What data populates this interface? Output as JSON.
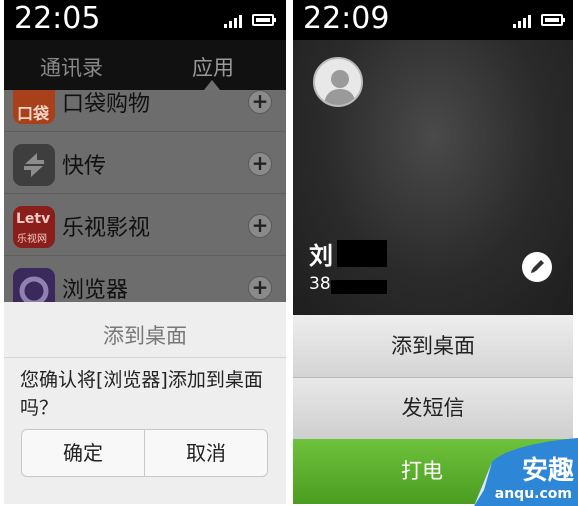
{
  "left_screen": {
    "status": {
      "time": "22:05"
    },
    "tabs": [
      {
        "label": "通讯录"
      },
      {
        "label": "应用"
      }
    ],
    "apps": [
      {
        "name": "口袋购物",
        "icon": "koudai-icon",
        "icon_text": "口袋"
      },
      {
        "name": "快传",
        "icon": "kuaichuan-icon"
      },
      {
        "name": "乐视影视",
        "icon": "letv-icon",
        "icon_text_top": "Letv",
        "icon_text_bottom": "乐视网"
      },
      {
        "name": "浏览器",
        "icon": "browser-icon"
      }
    ],
    "add_label": "+",
    "dialog": {
      "title": "添到桌面",
      "message": "您确认将[浏览器]添加到桌面吗？",
      "ok_label": "确定",
      "cancel_label": "取消"
    }
  },
  "right_screen": {
    "status": {
      "time": "22:09"
    },
    "contact": {
      "name": "刘",
      "number": "38"
    },
    "actions": {
      "add_to_desktop": "添到桌面",
      "send_sms": "发短信",
      "call": "打电"
    }
  },
  "watermark": {
    "text": "安趣",
    "url": "anqu.com"
  },
  "colors": {
    "call_green": "#5aae2b",
    "koudai_orange": "#e2571f",
    "letv_red": "#d42b27",
    "browser_purple": "#5b3e8e"
  }
}
